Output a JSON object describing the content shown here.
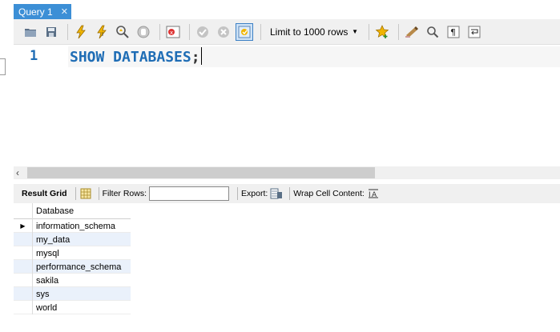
{
  "tab": {
    "title": "Query 1",
    "close_glyph": "✕"
  },
  "toolbar": {
    "icons": [
      "open-folder-icon",
      "save-icon",
      "execute-icon",
      "execute-current-icon",
      "explain-icon",
      "stop-icon",
      "toggle-error-icon",
      "commit-icon",
      "rollback-icon",
      "autocommit-icon",
      "bookmark-icon",
      "beautify-icon",
      "find-icon",
      "invisible-chars-icon",
      "wrap-icon"
    ],
    "limit_label": "Limit to 1000 rows"
  },
  "editor": {
    "line_number": "1",
    "code": "SHOW DATABASES",
    "semicolon": ";"
  },
  "result_bar": {
    "result_grid_label": "Result Grid",
    "filter_label": "Filter Rows:",
    "filter_value": "",
    "export_label": "Export:",
    "wrap_label": "Wrap Cell Content:"
  },
  "grid": {
    "column": "Database",
    "rows": [
      "information_schema",
      "my_data",
      "mysql",
      "performance_schema",
      "sakila",
      "sys",
      "world"
    ]
  },
  "colors": {
    "accent": "#3c8fd6",
    "keyword": "#1f6db5",
    "alt_row": "#eaf1fb"
  }
}
